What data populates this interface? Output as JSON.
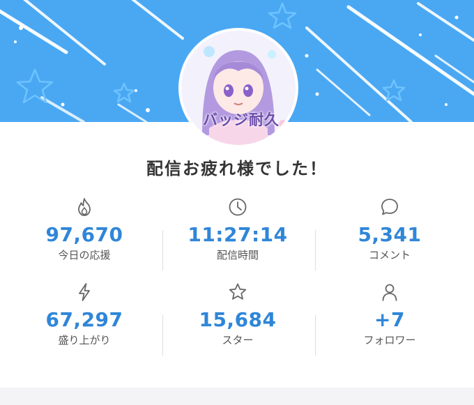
{
  "header": {
    "avatar_badge_text": "バッジ耐久",
    "banner_color": "#4aa8f3"
  },
  "title": "配信お疲れ様でした！",
  "accent_color": "#2f86d8",
  "stats": [
    {
      "icon": "fire-icon",
      "value": "97,670",
      "label": "今日の応援"
    },
    {
      "icon": "clock-icon",
      "value": "11:27:14",
      "label": "配信時間"
    },
    {
      "icon": "comment-icon",
      "value": "5,341",
      "label": "コメント"
    },
    {
      "icon": "lightning-icon",
      "value": "67,297",
      "label": "盛り上がり"
    },
    {
      "icon": "star-icon",
      "value": "15,684",
      "label": "スター"
    },
    {
      "icon": "person-icon",
      "value": "+7",
      "label": "フォロワー"
    }
  ]
}
